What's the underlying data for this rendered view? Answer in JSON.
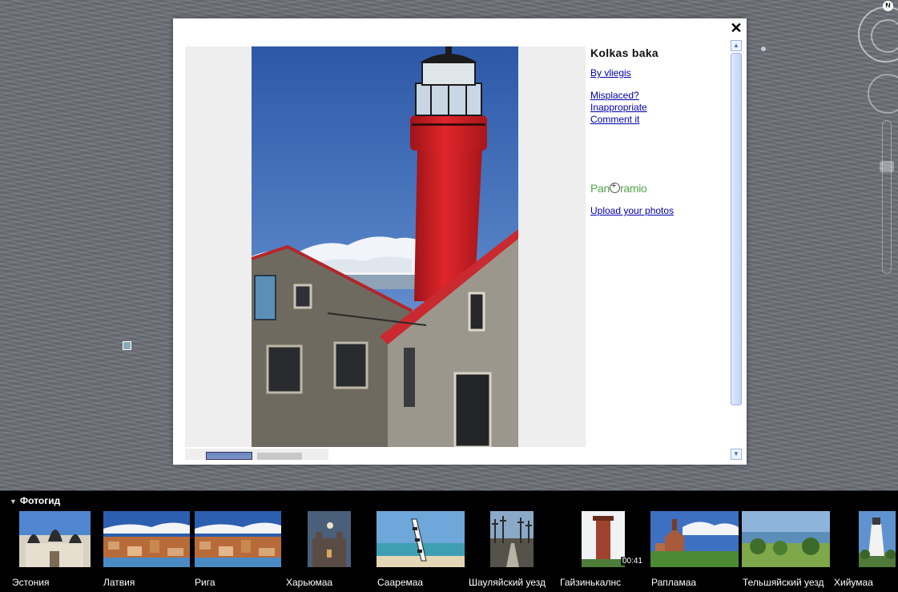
{
  "popup": {
    "close_label": "✕",
    "title": "Kolkas baka",
    "byline": "By vliegis",
    "actions": [
      "Misplaced?",
      "Inappropriate",
      "Comment it"
    ],
    "brand": {
      "pre": "Pan",
      "post": "ramio"
    },
    "upload": "Upload your photos"
  },
  "nav": {
    "north": "N"
  },
  "photo_guide": {
    "title": "Фотогид",
    "items": [
      {
        "label": "Эстония",
        "subject": "cathedral"
      },
      {
        "label": "Латвия",
        "subject": "city"
      },
      {
        "label": "Рига",
        "subject": "city"
      },
      {
        "label": "Харьюмаа",
        "subject": "castle-night"
      },
      {
        "label": "Сааремаа",
        "subject": "lighthouse-beach"
      },
      {
        "label": "Шауляйский уезд",
        "subject": "hill-of-crosses"
      },
      {
        "label": "Гайзинькалнс",
        "subject": "tower",
        "duration": "00:41"
      },
      {
        "label": "Рапламаа",
        "subject": "church"
      },
      {
        "label": "Тельшяйский уезд",
        "subject": "lake"
      },
      {
        "label": "Хийумаа",
        "subject": "lighthouse-white"
      }
    ]
  },
  "colors": {
    "link": "#0000aa",
    "brand_green": "#52a447",
    "lighthouse_red": "#d62828"
  }
}
